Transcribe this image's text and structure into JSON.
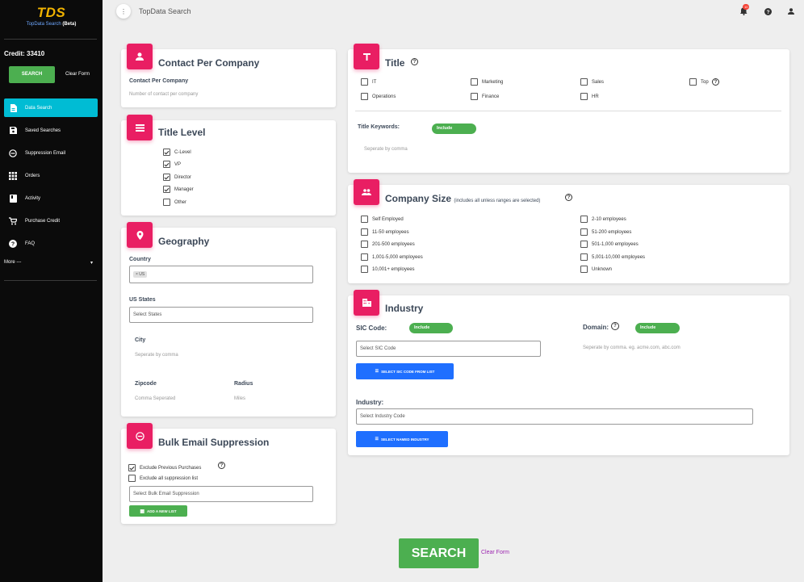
{
  "sidebar": {
    "logo": "TDS",
    "logo_sub": "TopData Search",
    "logo_beta": "(Beta)",
    "credit": "Credit: 33410",
    "search_label": "SEARCH",
    "clear_label": "Clear Form",
    "items": [
      {
        "label": "Data Search",
        "icon": "document-icon"
      },
      {
        "label": "Saved Searches",
        "icon": "save-icon"
      },
      {
        "label": "Suppression Email",
        "icon": "minus-circle-icon"
      },
      {
        "label": "Orders",
        "icon": "grid-icon"
      },
      {
        "label": "Activity",
        "icon": "book-icon"
      },
      {
        "label": "Purchase Credit",
        "icon": "cart-icon"
      },
      {
        "label": "FAQ",
        "icon": "help-icon"
      }
    ],
    "more_label": "More ---"
  },
  "topbar": {
    "title": "TopData Search",
    "notification_count": "10"
  },
  "contact": {
    "title": "Contact Per Company",
    "label": "Contact Per Company",
    "placeholder": "Number of contact per company"
  },
  "title_level": {
    "title": "Title Level",
    "options": [
      {
        "label": "C-Level",
        "checked": true
      },
      {
        "label": "VP",
        "checked": true
      },
      {
        "label": "Director",
        "checked": true
      },
      {
        "label": "Manager",
        "checked": true
      },
      {
        "label": "Other",
        "checked": false
      }
    ]
  },
  "geography": {
    "title": "Geography",
    "country_label": "Country",
    "country_chip": "× US",
    "states_label": "US States",
    "states_placeholder": "Select States",
    "city_label": "City",
    "city_placeholder": "Seperate by comma",
    "zip_label": "Zipcode",
    "zip_placeholder": "Comma Seperated",
    "radius_label": "Radius",
    "radius_placeholder": "Miles"
  },
  "bulk": {
    "title": "Bulk Email Suppression",
    "exclude_prev": "Exclude Previous Purchases",
    "exclude_all": "Exclude all suppression list",
    "select_placeholder": "Select Bulk Email Suppression",
    "add_label": "ADD A NEW LIST"
  },
  "title_card": {
    "title": "Title",
    "options": [
      "IT",
      "Marketing",
      "Sales",
      "Top",
      "Operations",
      "Finance",
      "HR"
    ],
    "keywords_label": "Title Keywords:",
    "include_label": "Include",
    "keywords_placeholder": "Seperate by comma"
  },
  "company_size": {
    "title": "Company Size",
    "note": "(includes all unless ranges are selected)",
    "left": [
      "Self Employed",
      "11-50 employees",
      "201-500 employees",
      "1,001-5,000 employees",
      "10,001+ employees"
    ],
    "right": [
      "2-10 employees",
      "51-200 employees",
      "501-1,000 employees",
      "5,001-10,000 employees",
      "Unknown"
    ]
  },
  "industry": {
    "title": "Industry",
    "sic_label": "SIC Code:",
    "sic_include": "Include",
    "sic_placeholder": "Select SIC Code",
    "sic_button": "SELECT SIC CODE FROM LIST",
    "domain_label": "Domain:",
    "domain_include": "Include",
    "domain_placeholder": "Seperate by comma. eg. acme.com, abc.com",
    "industry_label": "Industry:",
    "industry_placeholder": "Select Industry Code",
    "industry_button": "SELECT NAMED INDUSTRY"
  },
  "footer": {
    "search_label": "SEARCH",
    "clear_label": "Clear Form"
  },
  "colors": {
    "accent_pink": "#e91e63",
    "green": "#4caf50",
    "blue": "#1f6fff",
    "cyan": "#00bcd4"
  }
}
